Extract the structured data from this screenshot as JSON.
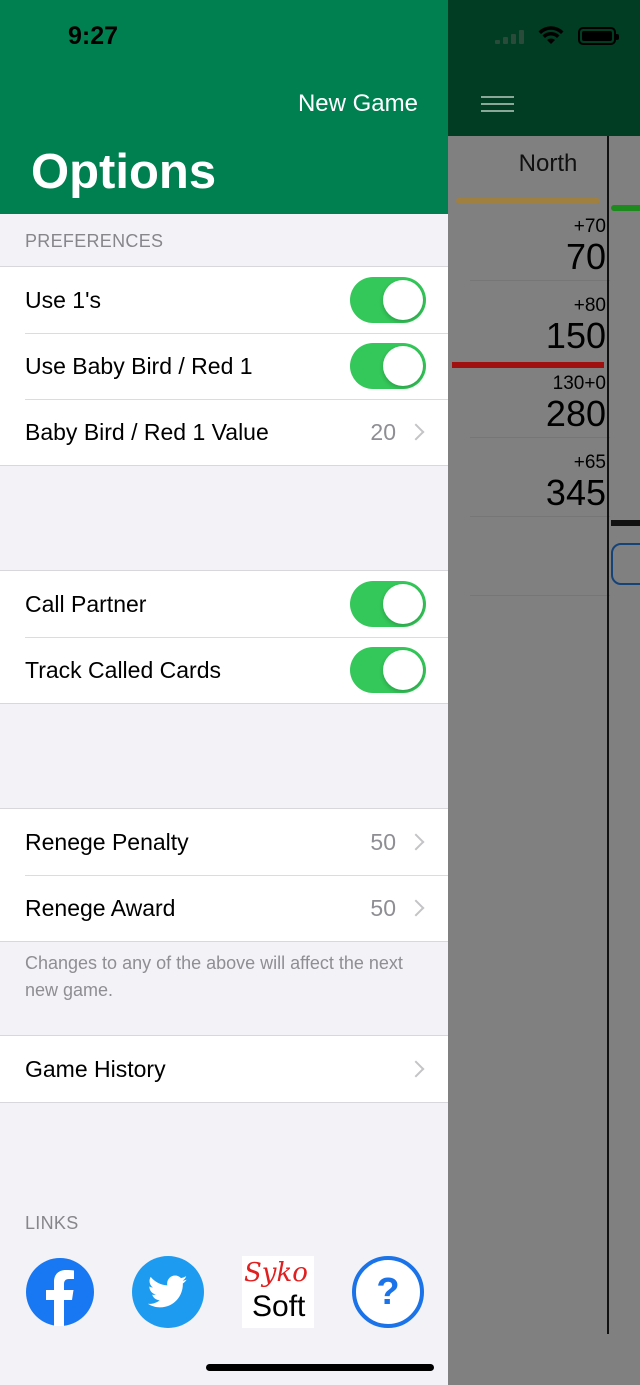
{
  "status_bar": {
    "time": "9:27"
  },
  "header": {
    "new_game_label": "New Game",
    "title": "Options"
  },
  "preferences": {
    "section_label": "PREFERENCES",
    "use_ones": {
      "label": "Use 1's",
      "on": true
    },
    "use_baby_bird": {
      "label": "Use Baby Bird / Red 1",
      "on": true
    },
    "baby_bird_value": {
      "label": "Baby Bird / Red 1 Value",
      "value": "20"
    }
  },
  "partner": {
    "call_partner": {
      "label": "Call Partner",
      "on": true
    },
    "track_called_cards": {
      "label": "Track Called Cards",
      "on": true
    }
  },
  "renege": {
    "penalty": {
      "label": "Renege Penalty",
      "value": "50"
    },
    "award": {
      "label": "Renege Award",
      "value": "50"
    },
    "footnote": "Changes to any of the above will affect the next new game."
  },
  "history": {
    "label": "Game History"
  },
  "links": {
    "section_label": "LINKS",
    "sykosoft_top": "Syko",
    "sykosoft_bottom": "Soft",
    "help_glyph": "?"
  },
  "background": {
    "column_title": "North",
    "scores": [
      {
        "delta": "+70",
        "total": "70"
      },
      {
        "delta": "+80",
        "total": "150"
      },
      {
        "delta": "130+0",
        "total": "280"
      },
      {
        "delta": "+65",
        "total": "345"
      }
    ]
  },
  "colors": {
    "header_green": "#008050",
    "toggle_green": "#34c759",
    "facebook": "#1877f2",
    "twitter": "#1d9bf0"
  }
}
